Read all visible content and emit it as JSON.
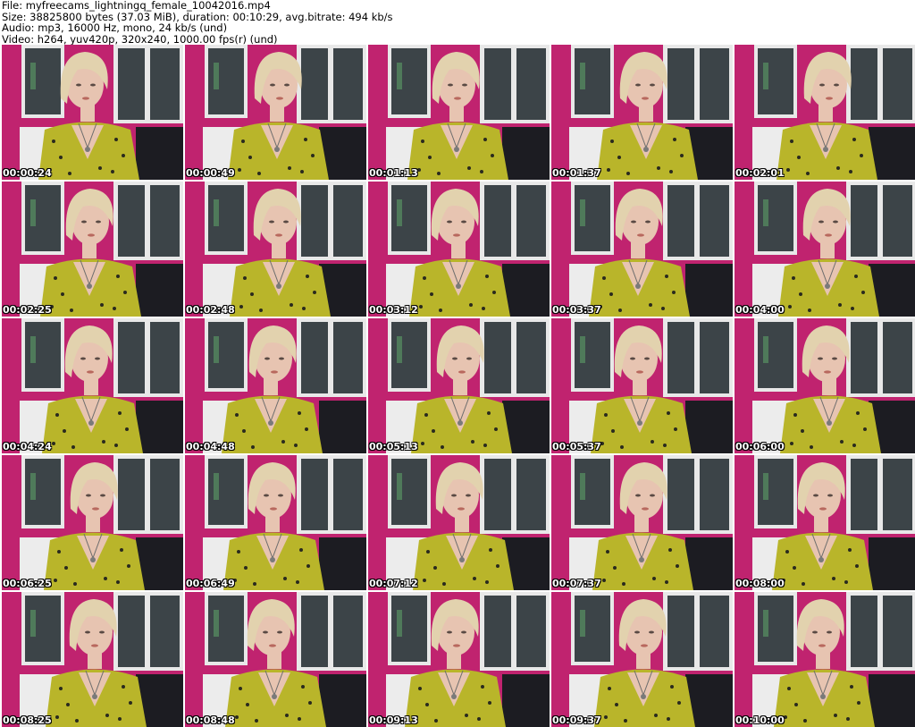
{
  "header": {
    "file_line": "File: myfreecams_lightningq_female_10042016.mp4",
    "size_line": "Size: 38825800 bytes (37.03 MiB), duration: 00:10:29, avg.bitrate: 494 kb/s",
    "audio_line": "Audio: mp3, 16000 Hz, mono, 24 kb/s (und)",
    "video_line": "Video: h264, yuv420p, 320x240, 1000.00 fps(r) (und)"
  },
  "thumbnails": [
    {
      "timestamp": "00:00:24"
    },
    {
      "timestamp": "00:00:49"
    },
    {
      "timestamp": "00:01:13"
    },
    {
      "timestamp": "00:01:37"
    },
    {
      "timestamp": "00:02:01"
    },
    {
      "timestamp": "00:02:25"
    },
    {
      "timestamp": "00:02:48"
    },
    {
      "timestamp": "00:03:12"
    },
    {
      "timestamp": "00:03:37"
    },
    {
      "timestamp": "00:04:00"
    },
    {
      "timestamp": "00:04:24"
    },
    {
      "timestamp": "00:04:48"
    },
    {
      "timestamp": "00:05:13"
    },
    {
      "timestamp": "00:05:37"
    },
    {
      "timestamp": "00:06:00"
    },
    {
      "timestamp": "00:06:25"
    },
    {
      "timestamp": "00:06:49"
    },
    {
      "timestamp": "00:07:12"
    },
    {
      "timestamp": "00:07:37"
    },
    {
      "timestamp": "00:08:00"
    },
    {
      "timestamp": "00:08:25"
    },
    {
      "timestamp": "00:08:48"
    },
    {
      "timestamp": "00:09:13"
    },
    {
      "timestamp": "00:09:37"
    },
    {
      "timestamp": "00:10:00"
    }
  ],
  "colors": {
    "wall": "#c0236f",
    "window": "#3c4448",
    "window_frame": "#e8e8e8",
    "sofa": "#ececec",
    "dress": "#b9b52a",
    "hair": "#e2d2ae",
    "skin": "#e7c4b1",
    "dark": "#1c1c22"
  }
}
